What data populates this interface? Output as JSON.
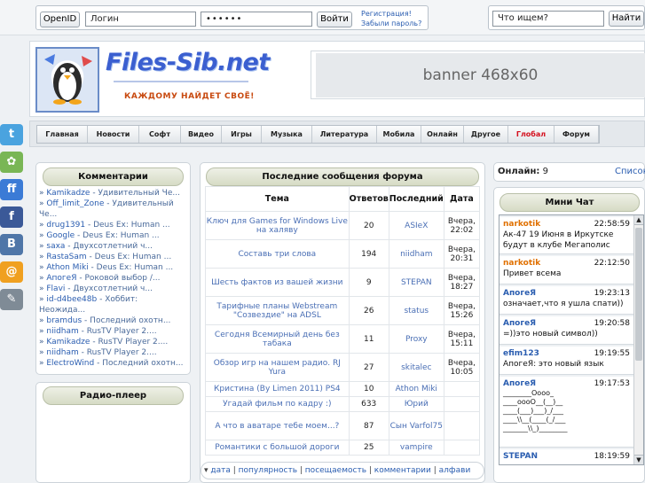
{
  "login": {
    "openid_label": "OpenID",
    "login_value": "Логин",
    "password_value": "••••••",
    "submit_label": "Войти",
    "register_link": "Регистрация!",
    "forgot_link": "Забыли пароль?"
  },
  "search": {
    "value": "Что ищем?",
    "button_label": "Найти"
  },
  "header": {
    "logo_text": "Files-Sib.net",
    "slogan": "КАЖДОМУ НАЙДЕТ СВОЁ!",
    "banner_text": "banner 468x60"
  },
  "nav": [
    {
      "label": "Главная",
      "w": 57
    },
    {
      "label": "Новости",
      "w": 58
    },
    {
      "label": "Софт",
      "w": 47
    },
    {
      "label": "Видео",
      "w": 46
    },
    {
      "label": "Игры",
      "w": 45
    },
    {
      "label": "Музыка",
      "w": 57
    },
    {
      "label": "Литература",
      "w": 73
    },
    {
      "label": "Мобила",
      "w": 50
    },
    {
      "label": "Онлайн",
      "w": 48
    },
    {
      "label": "Другое",
      "w": 50
    },
    {
      "label": "Глобал",
      "w": 52
    },
    {
      "label": "Форум",
      "w": 50
    }
  ],
  "social": [
    {
      "name": "twitter-icon",
      "glyph": "t",
      "color": "#4aa3df"
    },
    {
      "name": "google-buzz-icon",
      "glyph": "✿",
      "color": "#79b655"
    },
    {
      "name": "friendfeed-icon",
      "glyph": "ff",
      "color": "#3b7bd6"
    },
    {
      "name": "facebook-icon",
      "glyph": "f",
      "color": "#3b5998"
    },
    {
      "name": "vkontakte-icon",
      "glyph": "B",
      "color": "#4f76a8"
    },
    {
      "name": "mail-ru-icon",
      "glyph": "@",
      "color": "#f0a020"
    },
    {
      "name": "bookmark-icon",
      "glyph": "✎",
      "color": "#7f8b96"
    }
  ],
  "comments": {
    "title": "Комментарии",
    "items": [
      {
        "user": "Kamikadze",
        "text": "Удивительный Че..."
      },
      {
        "user": "Off_limit_Zone",
        "text": "Удивительный"
      },
      {
        "user": "",
        "text": "Че..."
      },
      {
        "user": "drug1391",
        "text": "Deus Ex: Human ..."
      },
      {
        "user": "Google",
        "text": "Deus Ex: Human ..."
      },
      {
        "user": "saxa",
        "text": "Двухсотлетний ч..."
      },
      {
        "user": "RastaSam",
        "text": "Deus Ex: Human ..."
      },
      {
        "user": "Athon Miki",
        "text": "Deus Ex: Human ..."
      },
      {
        "user": "АпогеЯ",
        "text": "Роковой выбор /..."
      },
      {
        "user": "Flavi",
        "text": "Двухсотлетний ч..."
      },
      {
        "user": "id-d4bee48b",
        "text": "Хоббит:"
      },
      {
        "user": "",
        "text": "Неожида..."
      },
      {
        "user": "bramdus",
        "text": "Последний охотн..."
      },
      {
        "user": "niidham",
        "text": "RusTV Player 2...."
      },
      {
        "user": "Kamikadze",
        "text": "RusTV Player 2...."
      },
      {
        "user": "niidham",
        "text": "RusTV Player 2...."
      },
      {
        "user": "ElectroWind",
        "text": "Последний охотн..."
      }
    ]
  },
  "radio": {
    "title": "Радио-плеер"
  },
  "forum": {
    "title": "Последние сообщения форума",
    "headers": {
      "topic": "Тема",
      "replies": "Ответов",
      "last": "Последний",
      "date": "Дата"
    },
    "rows": [
      {
        "topic": "Ключ для Games for Windows Live на халяву",
        "replies": "20",
        "author": "ASIeX",
        "date": "Вчера, 22:02"
      },
      {
        "topic": "Составь три слова",
        "replies": "194",
        "author": "niidham",
        "date": "Вчера, 20:31"
      },
      {
        "topic": "Шесть фактов из вашей жизни",
        "replies": "9",
        "author": "STEPAN",
        "date": "Вчера, 18:27"
      },
      {
        "topic": "Тарифные планы Webstream \"Созвездие\" на ADSL",
        "replies": "26",
        "author": "status",
        "date": "Вчера, 15:26"
      },
      {
        "topic": "Сегодня Всемирный день без табака",
        "replies": "11",
        "author": "Proxy",
        "date": "Вчера, 15:11"
      },
      {
        "topic": "Обзор игр на нашем радио. RJ Yura",
        "replies": "27",
        "author": "skitalec",
        "date": "Вчера, 10:05"
      },
      {
        "topic": "Кристина (By Limen 2011) PS4",
        "replies": "10",
        "author": "Athon Miki",
        "date": ""
      },
      {
        "topic": "Угадай фильм по кадру :)",
        "replies": "633",
        "author": "Юрий",
        "date": ""
      },
      {
        "topic": "А что в аватаре тебе моем...?",
        "replies": "87",
        "author": "Сын Varfol75",
        "date": ""
      },
      {
        "topic": "Романтики с большой дороги",
        "replies": "25",
        "author": "vampire",
        "date": ""
      }
    ],
    "sort": [
      "дата",
      "популярность",
      "посещаемость",
      "комментарии",
      "алфави"
    ]
  },
  "online": {
    "label": "Онлайн:",
    "count": "9",
    "list_link": "Список"
  },
  "chat": {
    "title": "Мини Чат",
    "messages": [
      {
        "user": "narkotik",
        "color": "#e07000",
        "time": "22:58:59",
        "text": "Ак-47 19 Июня в Иркутске\nбудут в клубе Мегаполис"
      },
      {
        "user": "narkotik",
        "color": "#e07000",
        "time": "22:12:50",
        "text": "Привет всема"
      },
      {
        "user": "АпогеЯ",
        "color": "#2a5db0",
        "time": "19:23:13",
        "text": "означает,что я ушла спати))"
      },
      {
        "user": "АпогеЯ",
        "color": "#2a5db0",
        "time": "19:20:58",
        "text": "=))это новый символ))"
      },
      {
        "user": "efim123",
        "color": "#2a5db0",
        "time": "19:19:55",
        "text": "АпогеЯ: это новый язык"
      },
      {
        "user": "АпогеЯ",
        "color": "#2a5db0",
        "time": "19:17:53",
        "text": "________Oooo_\n____oooO__(__)__\n____(___)___)_/___\n____\\\\__(____(_/___\n_______\\\\_)________"
      },
      {
        "user": "STEPAN",
        "color": "#2a5db0",
        "time": "18:19:59",
        "text": ""
      }
    ]
  }
}
